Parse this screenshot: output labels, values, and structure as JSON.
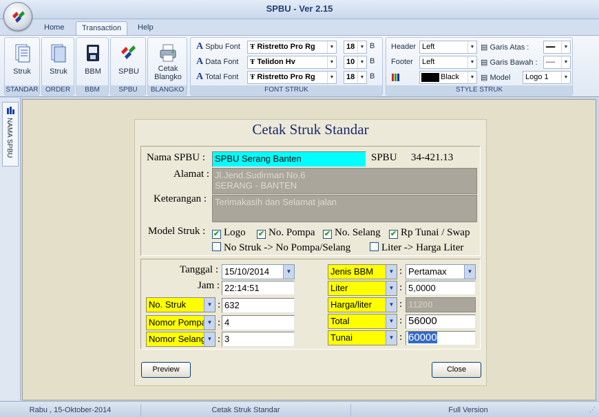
{
  "app": {
    "title": "SPBU - Ver 2.15"
  },
  "tabs": [
    "Home",
    "Transaction",
    "Help"
  ],
  "ribbon": {
    "buttons": {
      "struk": "Struk",
      "order": "Struk",
      "bbm": "BBM",
      "spbu": "SPBU",
      "blangko": "Cetak\nBlangko"
    },
    "groups": {
      "standar": "STANDAR",
      "order": "ORDER",
      "bbm": "BBM",
      "spbu": "SPBU",
      "blangko": "BLANGKO",
      "font": "FONT STRUK",
      "style": "STYLE STRUK"
    },
    "font_struk": {
      "spbu_label": "Spbu Font",
      "spbu_font": "Ristretto Pro Rg",
      "spbu_size": "18",
      "data_label": "Data Font",
      "data_font": "Telidon Hv",
      "data_size": "10",
      "total_label": "Total Font",
      "total_font": "Ristretto Pro Rg",
      "total_size": "18",
      "bold_label": "B"
    },
    "style_struk": {
      "header_label": "Header",
      "header_value": "Left",
      "footer_label": "Footer",
      "footer_value": "Left",
      "color_value": "Black",
      "garis_atas_label": "Garis Atas :",
      "garis_bawah_label": "Garis Bawah :",
      "model_label": "Model",
      "model_value": "Logo 1"
    }
  },
  "sidebar": {
    "tab_label": "NAMA SPBU"
  },
  "dialog": {
    "title": "Cetak Struk Standar",
    "nama_spbu_label": "Nama SPBU :",
    "nama_spbu_value": "SPBU Serang Banten",
    "spbu_code_label": "SPBU",
    "spbu_code_value": "34-421.13",
    "alamat_label": "Alamat :",
    "alamat_value": "Jl.Jend.Sudirman No.6\nSERANG - BANTEN",
    "keterangan_label": "Keterangan :",
    "keterangan_value": "Terimakasih dan Selamat jalan",
    "model_struk_label": "Model Struk :",
    "checkboxes": [
      {
        "label": "Logo",
        "checked": true
      },
      {
        "label": "No. Pompa",
        "checked": true
      },
      {
        "label": "No. Selang",
        "checked": true
      },
      {
        "label": "Rp Tunai / Swap",
        "checked": true
      },
      {
        "label": "No Struk -> No Pompa/Selang",
        "checked": false
      },
      {
        "label": "Liter -> Harga Liter",
        "checked": false
      }
    ],
    "tanggal_label": "Tanggal :",
    "tanggal_value": "15/10/2014",
    "jam_label": "Jam :",
    "jam_value": "22:14:51",
    "left_fields": [
      {
        "label": "No. Struk",
        "value": "632"
      },
      {
        "label": "Nomor Pompa",
        "value": "4"
      },
      {
        "label": "Nomor Selang",
        "value": "3"
      }
    ],
    "right_fields": [
      {
        "label": "Jenis BBM",
        "value": "Pertamax"
      },
      {
        "label": "Liter",
        "value": "5,0000"
      },
      {
        "label": "Harga/liter",
        "value": "11200"
      },
      {
        "label": "Total",
        "value": "56000"
      },
      {
        "label": "Tunai",
        "value": "60000"
      }
    ],
    "colon": ":",
    "preview_button": "Preview",
    "close_button": "Close"
  },
  "statusbar": {
    "date": "Rabu , 15-Oktober-2014",
    "screen": "Cetak Struk Standar",
    "version": "Full Version"
  },
  "colors": {
    "highlight_cyan": "#00ffff",
    "label_yellow": "#ffff00",
    "title_blue": "#1a2a6c"
  }
}
